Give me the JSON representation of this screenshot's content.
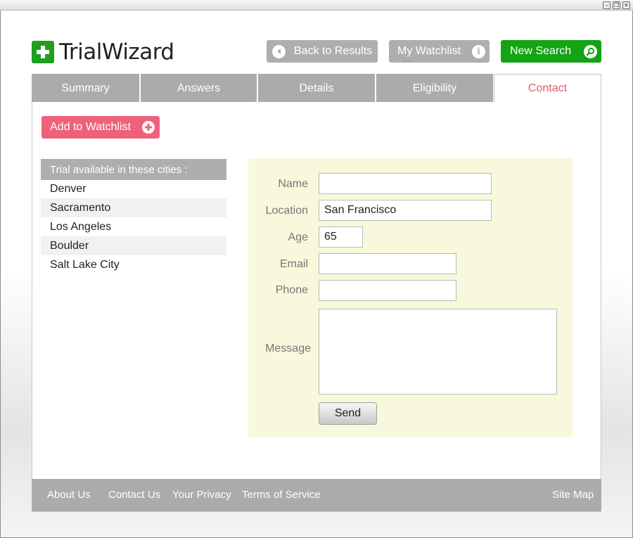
{
  "logo": {
    "text": "TrialWizard"
  },
  "header": {
    "back_label": "Back to Results",
    "watchlist_label": "My Watchlist",
    "new_search_label": "New Search"
  },
  "tabs": [
    {
      "label": "Summary"
    },
    {
      "label": "Answers"
    },
    {
      "label": "Details"
    },
    {
      "label": "Eligibility"
    },
    {
      "label": "Contact",
      "active": true
    }
  ],
  "watchlist_button": {
    "label": "Add to Watchlist"
  },
  "cities": {
    "heading": "Trial available in these cities :",
    "items": [
      "Denver",
      "Sacramento",
      "Los Angeles",
      "Boulder",
      "Salt Lake City"
    ]
  },
  "form": {
    "name_label": "Name",
    "name_value": "",
    "location_label": "Location",
    "location_value": "San Francisco",
    "age_label": "Age",
    "age_value": "65",
    "email_label": "Email",
    "email_value": "",
    "phone_label": "Phone",
    "phone_value": "",
    "message_label": "Message",
    "message_value": "",
    "send_label": "Send"
  },
  "footer": {
    "links": [
      "About Us",
      "Contact Us",
      "Your Privacy",
      "Terms of Service"
    ],
    "sitemap": "Site Map"
  },
  "colors": {
    "brand_green": "#1f9e1f",
    "accent_pink": "#ef607a",
    "tab_gray": "#ababab",
    "form_bg": "#f8f8dc"
  },
  "icons": {
    "back": "chevron-left-icon",
    "watchlist": "info-icon",
    "search": "search-icon",
    "add": "plus-circle-icon"
  }
}
